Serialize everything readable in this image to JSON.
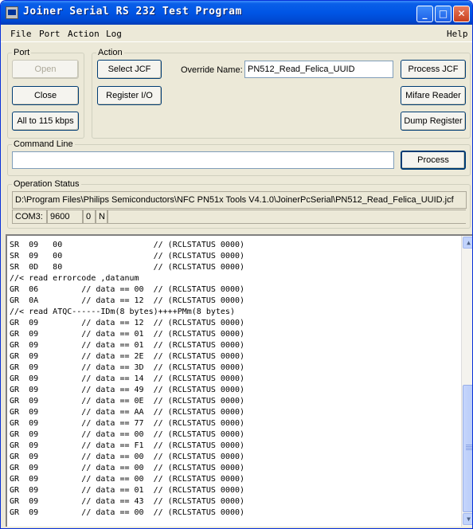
{
  "window": {
    "title": "Joiner Serial RS 232 Test Program",
    "minimize_glyph": "_",
    "maximize_glyph": "□",
    "close_glyph": "✕"
  },
  "menu": {
    "file": "File",
    "port": "Port",
    "action": "Action",
    "log": "Log",
    "help": "Help"
  },
  "port": {
    "legend": "Port",
    "open_label": "Open",
    "close_label": "Close",
    "baud_label": "All to 115 kbps"
  },
  "action": {
    "legend": "Action",
    "select_jcf_label": "Select JCF",
    "register_io_label": "Register I/O",
    "override_name_label": "Override Name:",
    "override_name_value": "PN512_Read_Felica_UUID",
    "process_jcf_label": "Process JCF",
    "mifare_reader_label": "Mifare Reader",
    "dump_register_label": "Dump Register"
  },
  "command_line": {
    "legend": "Command Line",
    "value": "",
    "process_label": "Process"
  },
  "operation_status": {
    "legend": "Operation Status",
    "path": "D:\\Program Files\\Philips Semiconductors\\NFC PN51x Tools V4.1.0\\JoinerPcSerial\\PN512_Read_Felica_UUID.jcf",
    "com_port": "COM3:",
    "baud": "9600",
    "flag1": "0",
    "flag2": "N"
  },
  "log_lines": [
    "SR  09   00                   // (RCLSTATUS 0000)",
    "SR  09   00                   // (RCLSTATUS 0000)",
    "SR  0D   80                   // (RCLSTATUS 0000)",
    "//< read errorcode ,datanum",
    "GR  06         // data == 00  // (RCLSTATUS 0000)",
    "GR  0A         // data == 12  // (RCLSTATUS 0000)",
    "//< read ATQC------IDm(8 bytes)++++PMm(8 bytes)",
    "GR  09         // data == 12  // (RCLSTATUS 0000)",
    "GR  09         // data == 01  // (RCLSTATUS 0000)",
    "GR  09         // data == 01  // (RCLSTATUS 0000)",
    "GR  09         // data == 2E  // (RCLSTATUS 0000)",
    "GR  09         // data == 3D  // (RCLSTATUS 0000)",
    "GR  09         // data == 14  // (RCLSTATUS 0000)",
    "GR  09         // data == 49  // (RCLSTATUS 0000)",
    "GR  09         // data == 0E  // (RCLSTATUS 0000)",
    "GR  09         // data == AA  // (RCLSTATUS 0000)",
    "GR  09         // data == 77  // (RCLSTATUS 0000)",
    "GR  09         // data == 00  // (RCLSTATUS 0000)",
    "GR  09         // data == F1  // (RCLSTATUS 0000)",
    "GR  09         // data == 00  // (RCLSTATUS 0000)",
    "GR  09         // data == 00  // (RCLSTATUS 0000)",
    "GR  09         // data == 00  // (RCLSTATUS 0000)",
    "GR  09         // data == 01  // (RCLSTATUS 0000)",
    "GR  09         // data == 43  // (RCLSTATUS 0000)",
    "GR  09         // data == 00  // (RCLSTATUS 0000)"
  ]
}
